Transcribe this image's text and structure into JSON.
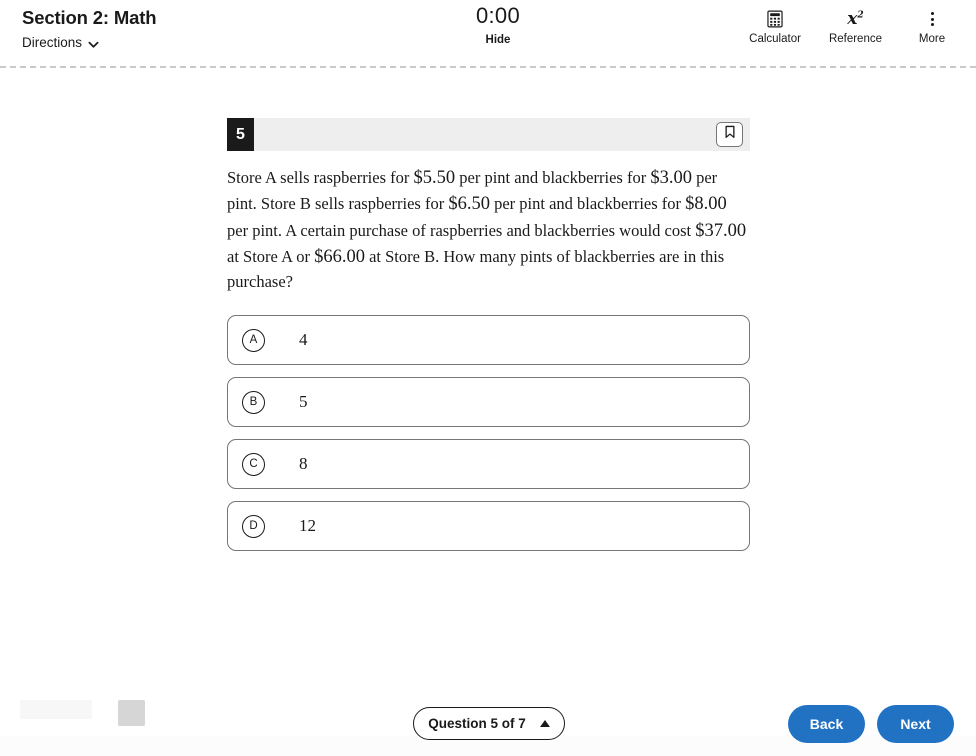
{
  "header": {
    "section_title": "Section 2: Math",
    "directions_label": "Directions",
    "directions_icon": "chevron-down-icon",
    "timer_value": "0:00",
    "timer_hide_label": "Hide",
    "tools": [
      {
        "label": "Calculator",
        "icon": "calculator-icon"
      },
      {
        "label": "Reference",
        "icon": "x-squared-icon",
        "glyph_base": "x",
        "glyph_sup": "2"
      },
      {
        "label": "More",
        "icon": "more-vertical-dots-icon"
      }
    ]
  },
  "question": {
    "number": "5",
    "bookmark_icon": "bookmark-icon",
    "text_parts": {
      "p1": "Store A sells raspberries for ",
      "m1": "$5.50",
      "p2": " per pint and blackberries for ",
      "m2": "$3.00",
      "p3": " per pint. Store B sells raspberries for ",
      "m3": "$6.50",
      "p4": " per pint and blackberries for ",
      "m4": "$8.00",
      "p5": " per pint. A certain purchase of raspberries and blackberries would cost ",
      "m5": "$37.00",
      "p6": " at Store A or ",
      "m6": "$66.00",
      "p7": " at Store B. How many pints of blackberries are in this purchase?"
    },
    "choices": [
      {
        "letter": "A",
        "text": "4"
      },
      {
        "letter": "B",
        "text": "5"
      },
      {
        "letter": "C",
        "text": "8"
      },
      {
        "letter": "D",
        "text": "12"
      }
    ]
  },
  "footer": {
    "question_nav_label": "Question 5 of 7",
    "question_nav_icon": "caret-up-icon",
    "back_label": "Back",
    "next_label": "Next"
  },
  "colors": {
    "accent_blue": "#2272c4",
    "badge_black": "#1a1a1a",
    "header_bar_gray": "#eeeeee",
    "border_gray": "#767676"
  }
}
